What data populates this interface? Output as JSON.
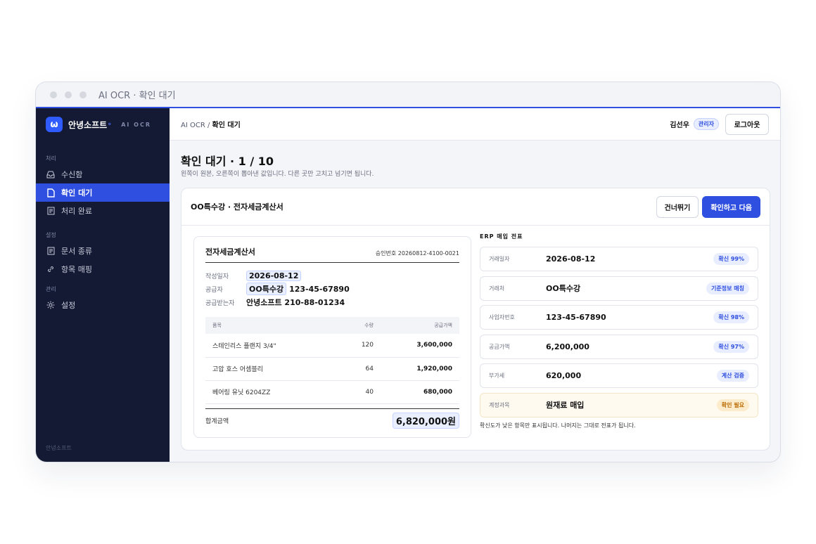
{
  "window": {
    "title": "AI OCR · 확인 대기"
  },
  "sidebar": {
    "brand_logo": "ω",
    "brand_name": "안녕소프트",
    "brand_dot": "°",
    "brand_sub": "AI OCR",
    "sections": {
      "process": "처리",
      "settings": "설정",
      "admin": "관리"
    },
    "items": {
      "inbox": "수신함",
      "pending": "확인 대기",
      "done": "처리 완료",
      "doc_types": "문서 종류",
      "field_mapping": "항목 매핑",
      "settings": "설정"
    },
    "footer": "안녕소프트"
  },
  "topbar": {
    "crumb_root": "AI OCR /",
    "crumb_current": "확인 대기",
    "user_name": "김선우",
    "role": "관리자",
    "logout_label": "로그아웃"
  },
  "page": {
    "title": "확인 대기 · 1 / 10",
    "subtitle": "왼쪽이 원본, 오른쪽이 뽑아낸 값입니다. 다른 곳만 고치고 넘기면 됩니다."
  },
  "card": {
    "title": "OO특수강 · 전자세금계산서",
    "skip_label": "건너뛰기",
    "confirm_label": "확인하고 다음"
  },
  "invoice": {
    "title": "전자세금계산서",
    "approval": "승인번호 20260812-4100-0021",
    "date_label": "작성일자",
    "date_value": "2026-08-12",
    "supplier_label": "공급자",
    "supplier_name": "OO특수강",
    "supplier_reg": "123-45-67890",
    "buyer_label": "공급받는자",
    "buyer_value": "안녕소프트 210-88-01234",
    "columns": [
      "품목",
      "수량",
      "공급가액"
    ],
    "rows": [
      {
        "item": "스테인리스 플랜지 3/4\"",
        "qty": "120",
        "amount": "3,600,000"
      },
      {
        "item": "고압 호스 어셈블리",
        "qty": "64",
        "amount": "1,920,000"
      },
      {
        "item": "베어링 유닛 6204ZZ",
        "qty": "40",
        "amount": "680,000"
      }
    ],
    "total_label": "합계금액",
    "total_value": "6,820,000원"
  },
  "erp": {
    "title": "ERP 매입 전표",
    "rows": [
      {
        "label": "거래일자",
        "value": "2026-08-12",
        "badge": "확신 99%",
        "status": "ok"
      },
      {
        "label": "거래처",
        "value": "OO특수강",
        "badge": "기준정보 매칭",
        "status": "ok"
      },
      {
        "label": "사업자번호",
        "value": "123-45-67890",
        "badge": "확신 98%",
        "status": "ok"
      },
      {
        "label": "공급가액",
        "value": "6,200,000",
        "badge": "확신 97%",
        "status": "ok"
      },
      {
        "label": "부가세",
        "value": "620,000",
        "badge": "계산 검증",
        "status": "ok"
      },
      {
        "label": "계정과목",
        "value": "원재료 매입",
        "badge": "확인 필요",
        "status": "warn"
      }
    ],
    "note": "확신도가 낮은 항목만 표시됩니다. 나머지는 그대로 전표가 됩니다."
  },
  "colors": {
    "accent": "#2f4fe0",
    "sidebar_bg": "#141a33",
    "warn": "#b86a00"
  }
}
